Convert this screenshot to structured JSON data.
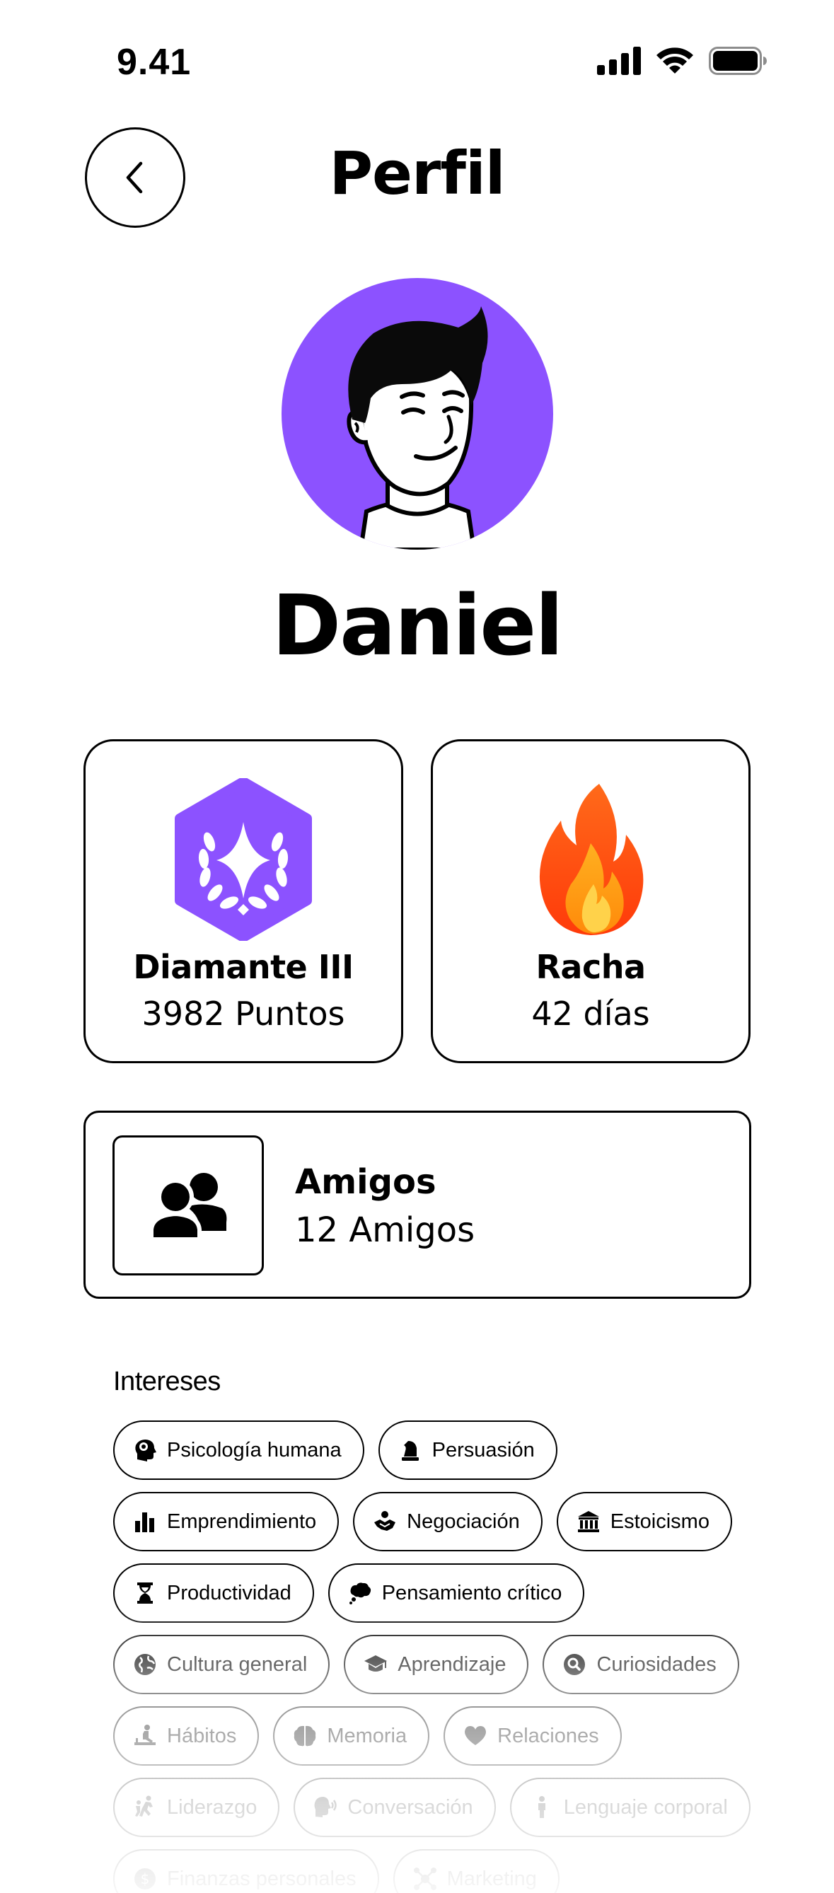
{
  "status_bar": {
    "time": "9.41",
    "signal_icon": "cellular-signal-icon",
    "wifi_icon": "wifi-icon",
    "battery_icon": "battery-icon"
  },
  "header": {
    "back_icon": "chevron-left-icon",
    "title": "Perfil"
  },
  "profile": {
    "avatar_color": "#8c52ff",
    "name": "Daniel"
  },
  "stats": {
    "league": {
      "icon": "diamond-league-badge-icon",
      "title": "Diamante III",
      "subtitle": "3982 Puntos",
      "color": "#8c52ff"
    },
    "streak": {
      "icon": "fire-icon",
      "title": "Racha",
      "subtitle": "42 días"
    }
  },
  "friends": {
    "icon": "friends-icon",
    "title": "Amigos",
    "subtitle": "12 Amigos"
  },
  "interests": {
    "title": "Intereses",
    "chips": [
      [
        "Psicología humana",
        "Persuasión"
      ],
      [
        "Emprendimiento",
        "Negociación",
        "Estoicismo"
      ],
      [
        "Productividad",
        "Pensamiento crítico"
      ],
      [
        "Cultura general",
        "Aprendizaje",
        "Curiosidades"
      ],
      [
        "Hábitos",
        "Memoria",
        "Relaciones"
      ],
      [
        "Liderazgo",
        "Conversación",
        "Lenguaje corporal"
      ],
      [
        "Finanzas personales",
        "Marketing"
      ]
    ]
  }
}
